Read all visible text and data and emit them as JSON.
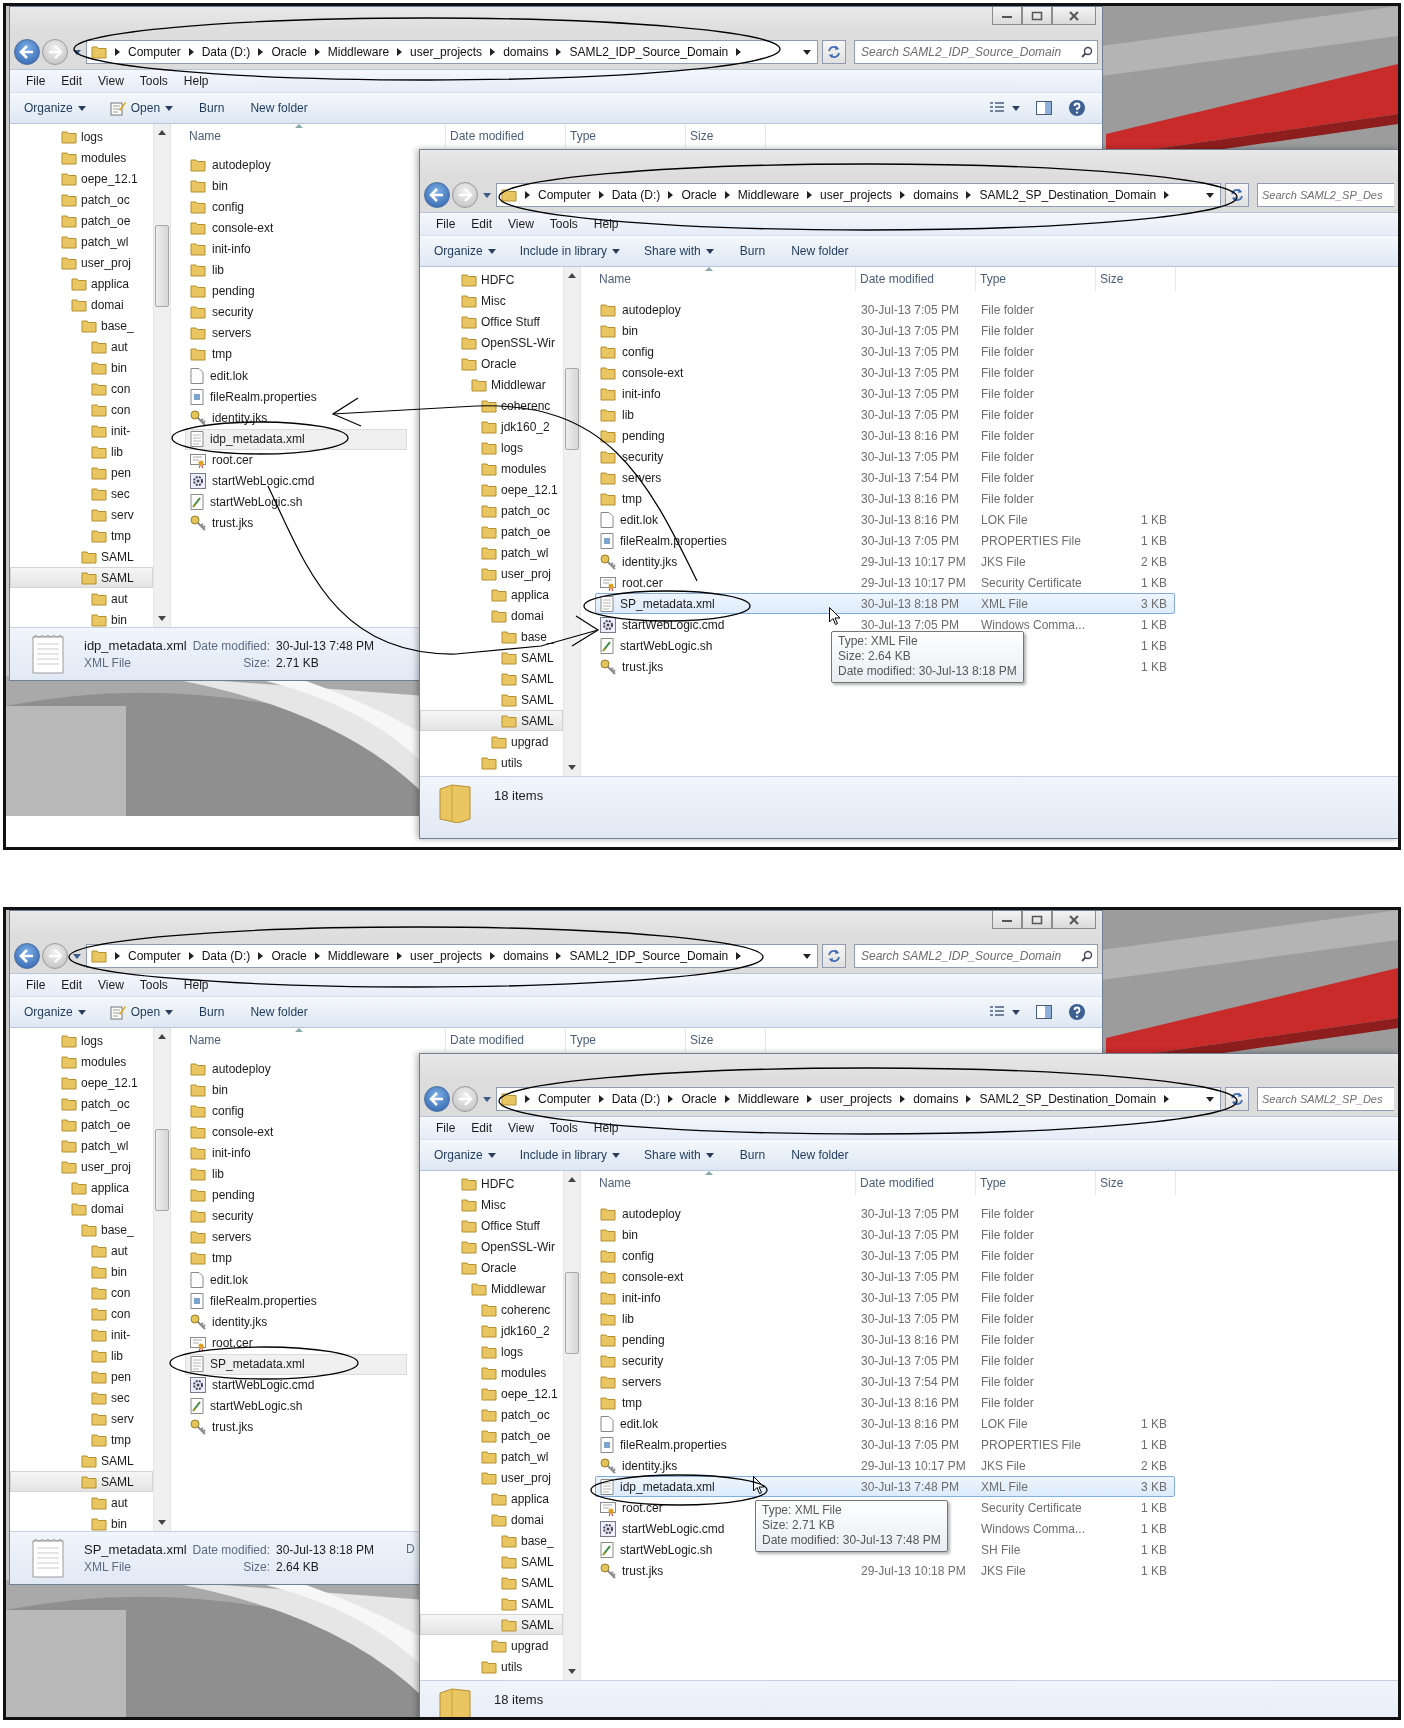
{
  "panels": [
    {
      "back_window": {
        "title_buttons": true,
        "view_buttons": true,
        "breadcrumbs": [
          "Computer",
          "Data (D:)",
          "Oracle",
          "Middleware",
          "user_projects",
          "domains",
          "SAML2_IDP_Source_Domain"
        ],
        "search": {
          "placeholder": "Search SAML2_IDP_Source_Domain"
        },
        "menu": [
          "File",
          "Edit",
          "View",
          "Tools",
          "Help"
        ],
        "toolbar": [
          {
            "label": "Organize",
            "kind": "menu",
            "dropdown": true
          },
          {
            "label": "Open",
            "kind": "open",
            "dropdown": true
          },
          {
            "label": "Burn",
            "kind": "action",
            "dropdown": false
          },
          {
            "label": "New folder",
            "kind": "action",
            "dropdown": false
          }
        ],
        "nav": [
          {
            "label": "logs",
            "selected": false
          },
          {
            "label": "modules",
            "selected": false
          },
          {
            "label": "oepe_12.1",
            "selected": false
          },
          {
            "label": "patch_oc",
            "selected": false
          },
          {
            "label": "patch_oe",
            "selected": false
          },
          {
            "label": "patch_wl",
            "selected": false
          },
          {
            "label": "user_proj",
            "selected": false,
            "children": [
              {
                "label": "applica",
                "selected": false
              },
              {
                "label": "domai",
                "selected": false,
                "children": [
                  {
                    "label": "base_",
                    "selected": false,
                    "children": [
                      {
                        "label": "aut",
                        "selected": false
                      },
                      {
                        "label": "bin",
                        "selected": false
                      },
                      {
                        "label": "con",
                        "selected": false
                      },
                      {
                        "label": "con",
                        "selected": false
                      },
                      {
                        "label": "init-",
                        "selected": false
                      },
                      {
                        "label": "lib",
                        "selected": false
                      },
                      {
                        "label": "pen",
                        "selected": false
                      },
                      {
                        "label": "sec",
                        "selected": false
                      },
                      {
                        "label": "serv",
                        "selected": false
                      },
                      {
                        "label": "tmp",
                        "selected": false
                      }
                    ]
                  },
                  {
                    "label": "SAML",
                    "selected": false
                  },
                  {
                    "label": "SAML",
                    "selected": true,
                    "children": [
                      {
                        "label": "aut",
                        "selected": false
                      },
                      {
                        "label": "bin",
                        "selected": false
                      }
                    ]
                  }
                ]
              }
            ]
          }
        ],
        "columns": [
          "Name",
          "Date modified",
          "Type",
          "Size"
        ],
        "files": [
          {
            "name": "autodeploy",
            "kind": "folder",
            "selected": false
          },
          {
            "name": "bin",
            "kind": "folder",
            "selected": false
          },
          {
            "name": "config",
            "kind": "folder",
            "selected": false
          },
          {
            "name": "console-ext",
            "kind": "folder",
            "selected": false
          },
          {
            "name": "init-info",
            "kind": "folder",
            "selected": false
          },
          {
            "name": "lib",
            "kind": "folder",
            "selected": false
          },
          {
            "name": "pending",
            "kind": "folder",
            "selected": false
          },
          {
            "name": "security",
            "kind": "folder",
            "selected": false
          },
          {
            "name": "servers",
            "kind": "folder",
            "selected": false
          },
          {
            "name": "tmp",
            "kind": "folder",
            "selected": false
          },
          {
            "name": "edit.lok",
            "kind": "file",
            "selected": false
          },
          {
            "name": "fileRealm.properties",
            "kind": "properties",
            "selected": false
          },
          {
            "name": "identity.jks",
            "kind": "key",
            "selected": false
          },
          {
            "name": "idp_metadata.xml",
            "kind": "xml",
            "selected": true
          },
          {
            "name": "root.cer",
            "kind": "cert",
            "selected": false
          },
          {
            "name": "startWebLogic.cmd",
            "kind": "cmd",
            "selected": false
          },
          {
            "name": "startWebLogic.sh",
            "kind": "script",
            "selected": false
          },
          {
            "name": "trust.jks",
            "kind": "key",
            "selected": false
          }
        ],
        "details": {
          "name": "idp_metadata.xml",
          "date_label": "Date modified:",
          "date": "30-Jul-13 7:48 PM",
          "type": "XML File",
          "size_label": "Size:",
          "size": "2.71 KB"
        }
      },
      "front_window": {
        "breadcrumbs": [
          "Computer",
          "Data (D:)",
          "Oracle",
          "Middleware",
          "user_projects",
          "domains",
          "SAML2_SP_Destination_Domain"
        ],
        "search": {
          "placeholder": "Search SAML2_SP_Des"
        },
        "menu": [
          "File",
          "Edit",
          "View",
          "Tools",
          "Help"
        ],
        "toolbar": [
          {
            "label": "Organize",
            "kind": "menu",
            "dropdown": true
          },
          {
            "label": "Include in library",
            "kind": "menu",
            "dropdown": true
          },
          {
            "label": "Share with",
            "kind": "menu",
            "dropdown": true
          },
          {
            "label": "Burn",
            "kind": "action",
            "dropdown": false
          },
          {
            "label": "New folder",
            "kind": "action",
            "dropdown": false
          }
        ],
        "nav": [
          {
            "label": "HDFC",
            "selected": false
          },
          {
            "label": "Misc",
            "selected": false
          },
          {
            "label": "Office Stuff",
            "selected": false
          },
          {
            "label": "OpenSSL-Wir",
            "selected": false
          },
          {
            "label": "Oracle",
            "selected": false,
            "children": [
              {
                "label": "Middlewar",
                "selected": false,
                "children": [
                  {
                    "label": "coherenc",
                    "selected": false
                  },
                  {
                    "label": "jdk160_2",
                    "selected": false
                  },
                  {
                    "label": "logs",
                    "selected": false
                  },
                  {
                    "label": "modules",
                    "selected": false
                  },
                  {
                    "label": "oepe_12.1",
                    "selected": false
                  },
                  {
                    "label": "patch_oc",
                    "selected": false
                  },
                  {
                    "label": "patch_oe",
                    "selected": false
                  },
                  {
                    "label": "patch_wl",
                    "selected": false
                  },
                  {
                    "label": "user_proj",
                    "selected": false,
                    "children": [
                      {
                        "label": "applica",
                        "selected": false
                      },
                      {
                        "label": "domai",
                        "selected": false,
                        "children": [
                          {
                            "label": "base_",
                            "selected": false
                          },
                          {
                            "label": "SAML",
                            "selected": false
                          },
                          {
                            "label": "SAML",
                            "selected": false
                          },
                          {
                            "label": "SAML",
                            "selected": false
                          },
                          {
                            "label": "SAML",
                            "selected": true
                          }
                        ]
                      },
                      {
                        "label": "upgrad",
                        "selected": false
                      }
                    ]
                  },
                  {
                    "label": "utils",
                    "selected": false
                  }
                ]
              }
            ]
          }
        ],
        "columns": [
          "Name",
          "Date modified",
          "Type",
          "Size"
        ],
        "files": [
          {
            "name": "autodeploy",
            "kind": "folder",
            "date": "30-Jul-13 7:05 PM",
            "type": "File folder",
            "selected": false
          },
          {
            "name": "bin",
            "kind": "folder",
            "date": "30-Jul-13 7:05 PM",
            "type": "File folder",
            "selected": false
          },
          {
            "name": "config",
            "kind": "folder",
            "date": "30-Jul-13 7:05 PM",
            "type": "File folder",
            "selected": false
          },
          {
            "name": "console-ext",
            "kind": "folder",
            "date": "30-Jul-13 7:05 PM",
            "type": "File folder",
            "selected": false
          },
          {
            "name": "init-info",
            "kind": "folder",
            "date": "30-Jul-13 7:05 PM",
            "type": "File folder",
            "selected": false
          },
          {
            "name": "lib",
            "kind": "folder",
            "date": "30-Jul-13 7:05 PM",
            "type": "File folder",
            "selected": false
          },
          {
            "name": "pending",
            "kind": "folder",
            "date": "30-Jul-13 8:16 PM",
            "type": "File folder",
            "selected": false
          },
          {
            "name": "security",
            "kind": "folder",
            "date": "30-Jul-13 7:05 PM",
            "type": "File folder",
            "selected": false
          },
          {
            "name": "servers",
            "kind": "folder",
            "date": "30-Jul-13 7:54 PM",
            "type": "File folder",
            "selected": false
          },
          {
            "name": "tmp",
            "kind": "folder",
            "date": "30-Jul-13 8:16 PM",
            "type": "File folder",
            "selected": false
          },
          {
            "name": "edit.lok",
            "kind": "file",
            "date": "30-Jul-13 8:16 PM",
            "type": "LOK File",
            "size": "1 KB",
            "selected": false
          },
          {
            "name": "fileRealm.properties",
            "kind": "properties",
            "date": "30-Jul-13 7:05 PM",
            "type": "PROPERTIES File",
            "size": "1 KB",
            "selected": false
          },
          {
            "name": "identity.jks",
            "kind": "key",
            "date": "29-Jul-13 10:17 PM",
            "type": "JKS File",
            "size": "2 KB",
            "selected": false
          },
          {
            "name": "root.cer",
            "kind": "cert",
            "date": "29-Jul-13 10:17 PM",
            "type": "Security Certificate",
            "size": "1 KB",
            "selected": false
          },
          {
            "name": "SP_metadata.xml",
            "kind": "xml",
            "date": "30-Jul-13 8:18 PM",
            "type": "XML File",
            "size": "3 KB",
            "selected": true
          },
          {
            "name": "startWebLogic.cmd",
            "kind": "cmd",
            "date": "30-Jul-13 7:05 PM",
            "type": "Windows Comma...",
            "size": "1 KB",
            "selected": false
          },
          {
            "name": "startWebLogic.sh",
            "kind": "script",
            "size": "1 KB",
            "selected": false
          },
          {
            "name": "trust.jks",
            "kind": "key",
            "size": "1 KB",
            "selected": false
          }
        ],
        "tooltip": [
          "Type: XML File",
          "Size: 2.64 KB",
          "Date modified: 30-Jul-13 8:18 PM"
        ],
        "status": "18 items"
      }
    },
    {
      "back_window": {
        "title_buttons": true,
        "view_buttons": true,
        "breadcrumbs": [
          "Computer",
          "Data (D:)",
          "Oracle",
          "Middleware",
          "user_projects",
          "domains",
          "SAML2_IDP_Source_Domain"
        ],
        "search": {
          "placeholder": "Search SAML2_IDP_Source_Domain"
        },
        "menu": [
          "File",
          "Edit",
          "View",
          "Tools",
          "Help"
        ],
        "toolbar": [
          {
            "label": "Organize",
            "kind": "menu",
            "dropdown": true
          },
          {
            "label": "Open",
            "kind": "open",
            "dropdown": true
          },
          {
            "label": "Burn",
            "kind": "action",
            "dropdown": false
          },
          {
            "label": "New folder",
            "kind": "action",
            "dropdown": false
          }
        ],
        "nav": [
          {
            "label": "logs",
            "selected": false
          },
          {
            "label": "modules",
            "selected": false
          },
          {
            "label": "oepe_12.1",
            "selected": false
          },
          {
            "label": "patch_oc",
            "selected": false
          },
          {
            "label": "patch_oe",
            "selected": false
          },
          {
            "label": "patch_wl",
            "selected": false
          },
          {
            "label": "user_proj",
            "selected": false,
            "children": [
              {
                "label": "applica",
                "selected": false
              },
              {
                "label": "domai",
                "selected": false,
                "children": [
                  {
                    "label": "base_",
                    "selected": false,
                    "children": [
                      {
                        "label": "aut",
                        "selected": false
                      },
                      {
                        "label": "bin",
                        "selected": false
                      },
                      {
                        "label": "con",
                        "selected": false
                      },
                      {
                        "label": "con",
                        "selected": false
                      },
                      {
                        "label": "init-",
                        "selected": false
                      },
                      {
                        "label": "lib",
                        "selected": false
                      },
                      {
                        "label": "pen",
                        "selected": false
                      },
                      {
                        "label": "sec",
                        "selected": false
                      },
                      {
                        "label": "serv",
                        "selected": false
                      },
                      {
                        "label": "tmp",
                        "selected": false
                      }
                    ]
                  },
                  {
                    "label": "SAML",
                    "selected": false
                  },
                  {
                    "label": "SAML",
                    "selected": true,
                    "children": [
                      {
                        "label": "aut",
                        "selected": false
                      },
                      {
                        "label": "bin",
                        "selected": false
                      }
                    ]
                  }
                ]
              }
            ]
          }
        ],
        "columns": [
          "Name",
          "Date modified",
          "Type",
          "Size"
        ],
        "files": [
          {
            "name": "autodeploy",
            "kind": "folder",
            "selected": false
          },
          {
            "name": "bin",
            "kind": "folder",
            "selected": false
          },
          {
            "name": "config",
            "kind": "folder",
            "selected": false
          },
          {
            "name": "console-ext",
            "kind": "folder",
            "selected": false
          },
          {
            "name": "init-info",
            "kind": "folder",
            "selected": false
          },
          {
            "name": "lib",
            "kind": "folder",
            "selected": false
          },
          {
            "name": "pending",
            "kind": "folder",
            "selected": false
          },
          {
            "name": "security",
            "kind": "folder",
            "selected": false
          },
          {
            "name": "servers",
            "kind": "folder",
            "selected": false
          },
          {
            "name": "tmp",
            "kind": "folder",
            "selected": false
          },
          {
            "name": "edit.lok",
            "kind": "file",
            "selected": false
          },
          {
            "name": "fileRealm.properties",
            "kind": "properties",
            "selected": false
          },
          {
            "name": "identity.jks",
            "kind": "key",
            "selected": false
          },
          {
            "name": "root.cer",
            "kind": "cert",
            "selected": false
          },
          {
            "name": "SP_metadata.xml",
            "kind": "xml",
            "selected": true
          },
          {
            "name": "startWebLogic.cmd",
            "kind": "cmd",
            "selected": false
          },
          {
            "name": "startWebLogic.sh",
            "kind": "script",
            "selected": false
          },
          {
            "name": "trust.jks",
            "kind": "key",
            "selected": false
          }
        ],
        "details": {
          "name": "SP_metadata.xml",
          "date_label": "Date modified:",
          "date": "30-Jul-13 8:18 PM",
          "type": "XML File",
          "size_label": "Size:",
          "size": "2.64 KB",
          "column_3": "D"
        }
      },
      "front_window": {
        "breadcrumbs": [
          "Computer",
          "Data (D:)",
          "Oracle",
          "Middleware",
          "user_projects",
          "domains",
          "SAML2_SP_Destination_Domain"
        ],
        "search": {
          "placeholder": "Search SAML2_SP_Des"
        },
        "menu": [
          "File",
          "Edit",
          "View",
          "Tools",
          "Help"
        ],
        "toolbar": [
          {
            "label": "Organize",
            "kind": "menu",
            "dropdown": true
          },
          {
            "label": "Include in library",
            "kind": "menu",
            "dropdown": true
          },
          {
            "label": "Share with",
            "kind": "menu",
            "dropdown": true
          },
          {
            "label": "Burn",
            "kind": "action",
            "dropdown": false
          },
          {
            "label": "New folder",
            "kind": "action",
            "dropdown": false
          }
        ],
        "nav": [
          {
            "label": "HDFC",
            "selected": false
          },
          {
            "label": "Misc",
            "selected": false
          },
          {
            "label": "Office Stuff",
            "selected": false
          },
          {
            "label": "OpenSSL-Wir",
            "selected": false
          },
          {
            "label": "Oracle",
            "selected": false,
            "children": [
              {
                "label": "Middlewar",
                "selected": false,
                "children": [
                  {
                    "label": "coherenc",
                    "selected": false
                  },
                  {
                    "label": "jdk160_2",
                    "selected": false
                  },
                  {
                    "label": "logs",
                    "selected": false
                  },
                  {
                    "label": "modules",
                    "selected": false
                  },
                  {
                    "label": "oepe_12.1",
                    "selected": false
                  },
                  {
                    "label": "patch_oc",
                    "selected": false
                  },
                  {
                    "label": "patch_oe",
                    "selected": false
                  },
                  {
                    "label": "patch_wl",
                    "selected": false
                  },
                  {
                    "label": "user_proj",
                    "selected": false,
                    "children": [
                      {
                        "label": "applica",
                        "selected": false
                      },
                      {
                        "label": "domai",
                        "selected": false,
                        "children": [
                          {
                            "label": "base_",
                            "selected": false
                          },
                          {
                            "label": "SAML",
                            "selected": false
                          },
                          {
                            "label": "SAML",
                            "selected": false
                          },
                          {
                            "label": "SAML",
                            "selected": false
                          },
                          {
                            "label": "SAML",
                            "selected": true
                          }
                        ]
                      },
                      {
                        "label": "upgrad",
                        "selected": false
                      }
                    ]
                  },
                  {
                    "label": "utils",
                    "selected": false
                  }
                ]
              }
            ]
          }
        ],
        "columns": [
          "Name",
          "Date modified",
          "Type",
          "Size"
        ],
        "files": [
          {
            "name": "autodeploy",
            "kind": "folder",
            "date": "30-Jul-13 7:05 PM",
            "type": "File folder",
            "selected": false
          },
          {
            "name": "bin",
            "kind": "folder",
            "date": "30-Jul-13 7:05 PM",
            "type": "File folder",
            "selected": false
          },
          {
            "name": "config",
            "kind": "folder",
            "date": "30-Jul-13 7:05 PM",
            "type": "File folder",
            "selected": false
          },
          {
            "name": "console-ext",
            "kind": "folder",
            "date": "30-Jul-13 7:05 PM",
            "type": "File folder",
            "selected": false
          },
          {
            "name": "init-info",
            "kind": "folder",
            "date": "30-Jul-13 7:05 PM",
            "type": "File folder",
            "selected": false
          },
          {
            "name": "lib",
            "kind": "folder",
            "date": "30-Jul-13 7:05 PM",
            "type": "File folder",
            "selected": false
          },
          {
            "name": "pending",
            "kind": "folder",
            "date": "30-Jul-13 8:16 PM",
            "type": "File folder",
            "selected": false
          },
          {
            "name": "security",
            "kind": "folder",
            "date": "30-Jul-13 7:05 PM",
            "type": "File folder",
            "selected": false
          },
          {
            "name": "servers",
            "kind": "folder",
            "date": "30-Jul-13 7:54 PM",
            "type": "File folder",
            "selected": false
          },
          {
            "name": "tmp",
            "kind": "folder",
            "date": "30-Jul-13 8:16 PM",
            "type": "File folder",
            "selected": false
          },
          {
            "name": "edit.lok",
            "kind": "file",
            "date": "30-Jul-13 8:16 PM",
            "type": "LOK File",
            "size": "1 KB",
            "selected": false
          },
          {
            "name": "fileRealm.properties",
            "kind": "properties",
            "date": "30-Jul-13 7:05 PM",
            "type": "PROPERTIES File",
            "size": "1 KB",
            "selected": false
          },
          {
            "name": "identity.jks",
            "kind": "key",
            "date": "29-Jul-13 10:17 PM",
            "type": "JKS File",
            "size": "2 KB",
            "selected": false
          },
          {
            "name": "idp_metadata.xml",
            "kind": "xml",
            "date": "30-Jul-13 7:48 PM",
            "type": "XML File",
            "size": "3 KB",
            "selected": true
          },
          {
            "name": "root.cer",
            "kind": "cert",
            "type": "Security Certificate",
            "size": "1 KB",
            "selected": false
          },
          {
            "name": "startWebLogic.cmd",
            "kind": "cmd",
            "type": "Windows Comma...",
            "size": "1 KB",
            "selected": false
          },
          {
            "name": "startWebLogic.sh",
            "kind": "script",
            "type": "SH File",
            "size": "1 KB",
            "selected": false
          },
          {
            "name": "trust.jks",
            "kind": "key",
            "date": "29-Jul-13 10:18 PM",
            "type": "JKS File",
            "size": "1 KB",
            "selected": false
          }
        ],
        "tooltip": [
          "Type: XML File",
          "Size: 2.71 KB",
          "Date modified: 30-Jul-13 7:48 PM"
        ],
        "status": "18 items"
      }
    }
  ]
}
